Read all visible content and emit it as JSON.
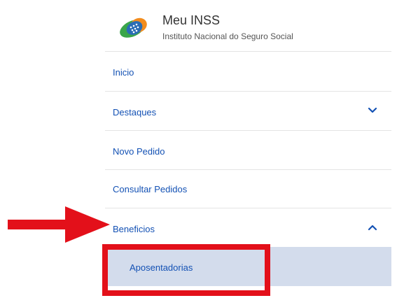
{
  "header": {
    "title": "Meu INSS",
    "subtitle": "Instituto Nacional do Seguro Social",
    "logo_icon": "inss-logo-icon"
  },
  "menu": {
    "items": [
      {
        "label": "Inicio",
        "expanded": null
      },
      {
        "label": "Destaques",
        "icon": "chevron-down-icon"
      },
      {
        "label": "Novo Pedido"
      },
      {
        "label": "Consultar Pedidos"
      },
      {
        "label": "Beneficios",
        "icon": "chevron-up-icon"
      }
    ],
    "submenu": {
      "label": "Aposentadorias"
    }
  },
  "colors": {
    "link": "#1351b4",
    "submenu_bg": "#d3dcec",
    "annotation": "#e3101a",
    "divider": "#e4e4e4",
    "logo_blue": "#2a6db5",
    "logo_green": "#3aa64a",
    "logo_orange": "#f28c1d"
  },
  "annotations": {
    "arrow_icon": "red-arrow-icon",
    "highlight": "red-highlight-box"
  }
}
